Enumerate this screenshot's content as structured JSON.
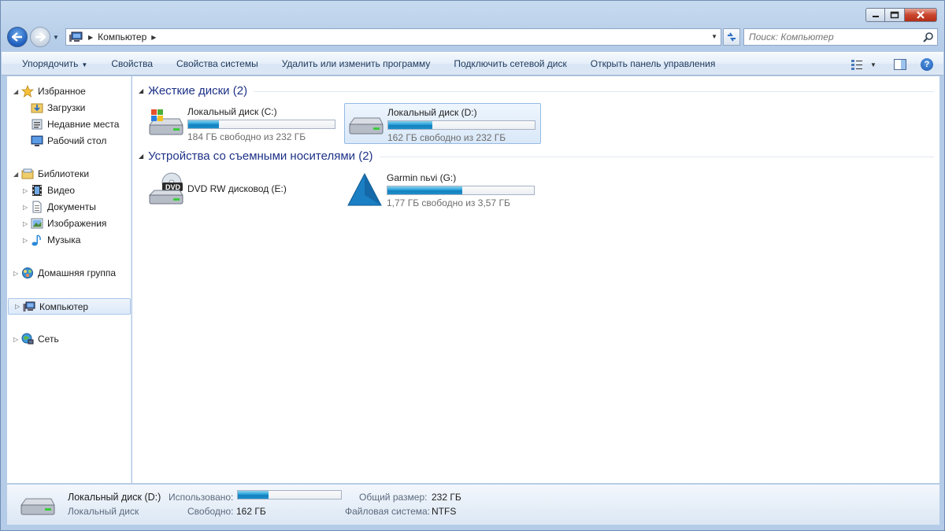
{
  "window": {
    "caption_buttons": {
      "min_icon": "minimize-icon",
      "max_icon": "maximize-icon",
      "close_icon": "close-icon"
    }
  },
  "navbar": {
    "address_segment": "Компьютер",
    "search_placeholder": "Поиск: Компьютер"
  },
  "toolbar": {
    "organize": "Упорядочить",
    "properties": "Свойства",
    "system_properties": "Свойства системы",
    "uninstall": "Удалить или изменить программу",
    "map_drive": "Подключить сетевой диск",
    "control_panel": "Открыть панель управления"
  },
  "nav_pane": {
    "favorites": "Избранное",
    "downloads": "Загрузки",
    "recent": "Недавние места",
    "desktop": "Рабочий стол",
    "libraries": "Библиотеки",
    "video": "Видео",
    "documents": "Документы",
    "images": "Изображения",
    "music": "Музыка",
    "homegroup": "Домашняя группа",
    "computer": "Компьютер",
    "network": "Сеть"
  },
  "groups": {
    "hard_drives": "Жесткие диски (2)",
    "removable": "Устройства со съемными носителями (2)"
  },
  "drives": {
    "c": {
      "name": "Локальный диск (C:)",
      "free": "184 ГБ свободно из 232 ГБ",
      "used_fraction": 0.21
    },
    "d": {
      "name": "Локальный диск (D:)",
      "free": "162 ГБ свободно из 232 ГБ",
      "used_fraction": 0.3
    },
    "e": {
      "name": "DVD RW дисковод (E:)",
      "badge": "DVD"
    },
    "g": {
      "name": "Garmin nьvi (G:)",
      "free": "1,77 ГБ свободно из 3,57 ГБ",
      "used_fraction": 0.51
    }
  },
  "details": {
    "name": "Локальный диск (D:)",
    "type": "Локальный диск",
    "used_label": "Использовано:",
    "used_fraction": 0.3,
    "free_label": "Свободно:",
    "free_value": "162 ГБ",
    "total_label": "Общий размер:",
    "total_value": "232 ГБ",
    "fs_label": "Файловая система:",
    "fs_value": "NTFS"
  },
  "colors": {
    "accent": "#1e3287",
    "bar_fill": "#26a0da",
    "close_red": "#c9452e"
  }
}
